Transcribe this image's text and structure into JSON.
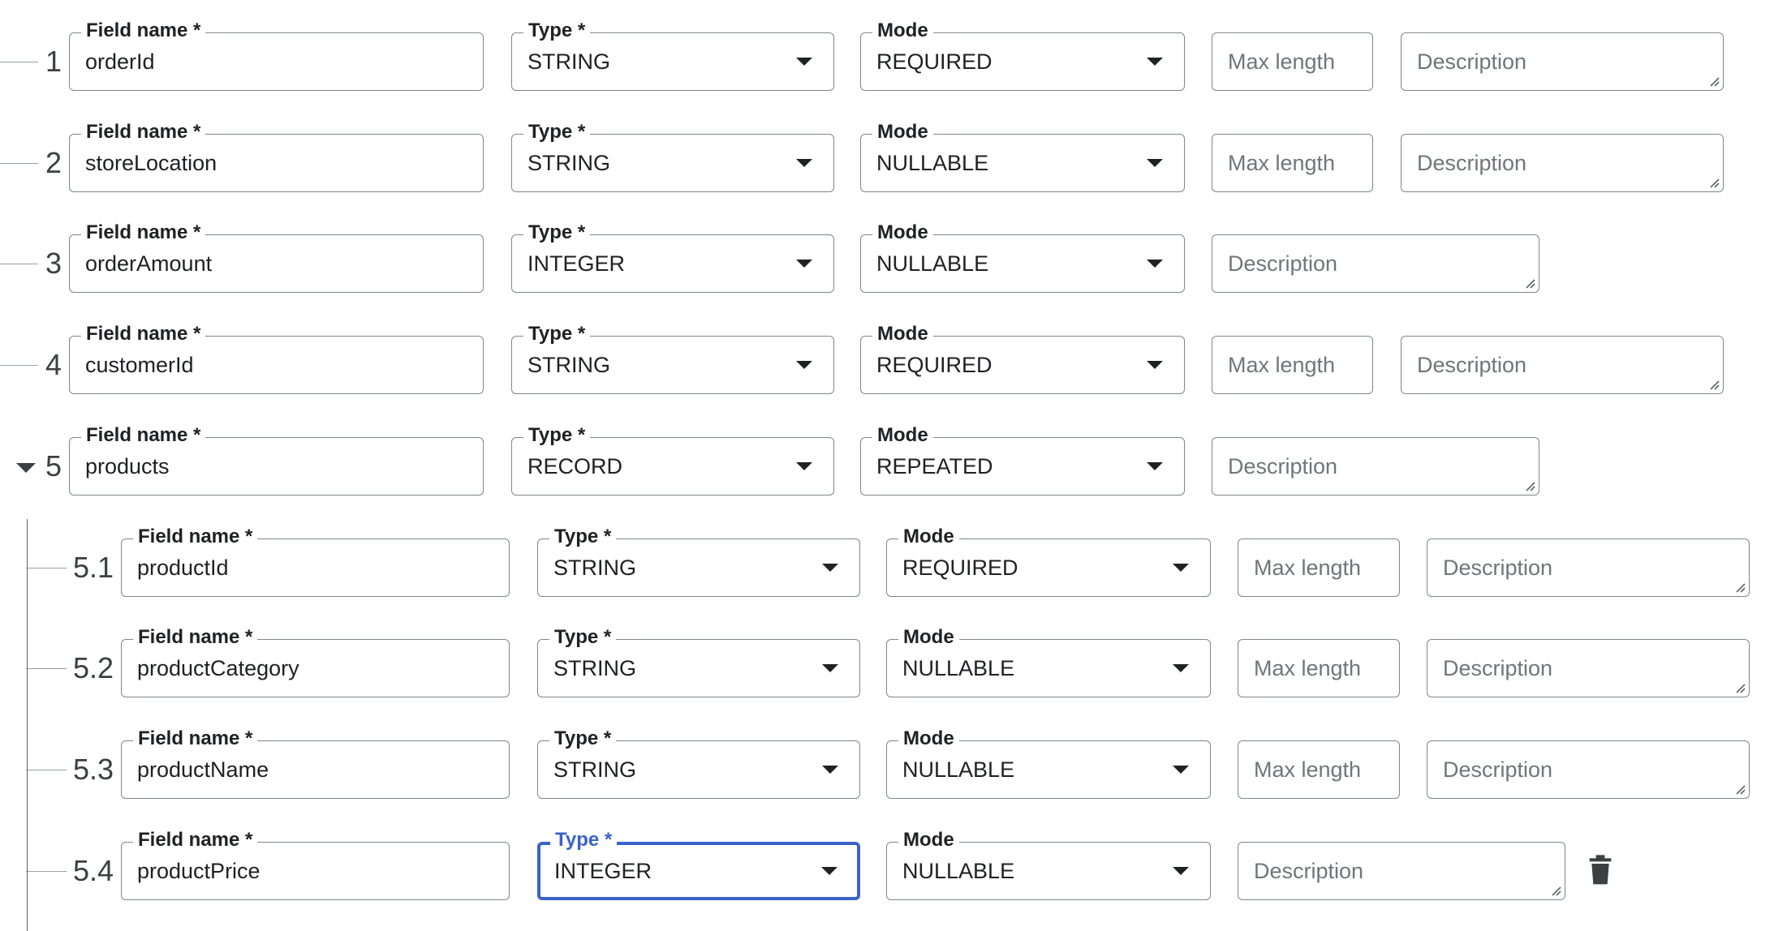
{
  "labels": {
    "field_name": "Field name *",
    "type": "Type *",
    "mode": "Mode",
    "max_length_placeholder": "Max length",
    "description_placeholder": "Description"
  },
  "icons": {
    "expand": "caret-down-icon",
    "dropdown": "arrow-drop-down-icon",
    "resize": "resize-grip-icon",
    "delete": "trash-icon"
  },
  "colors": {
    "focus_accent": "#3b62c9",
    "field_border": "#80868b"
  },
  "rows": [
    {
      "num": "1",
      "name": "orderId",
      "type": "STRING",
      "mode": "REQUIRED",
      "has_max_length": true
    },
    {
      "num": "2",
      "name": "storeLocation",
      "type": "STRING",
      "mode": "NULLABLE",
      "has_max_length": true
    },
    {
      "num": "3",
      "name": "orderAmount",
      "type": "INTEGER",
      "mode": "NULLABLE",
      "has_max_length": false
    },
    {
      "num": "4",
      "name": "customerId",
      "type": "STRING",
      "mode": "REQUIRED",
      "has_max_length": true
    },
    {
      "num": "5",
      "name": "products",
      "type": "RECORD",
      "mode": "REPEATED",
      "has_max_length": false,
      "expanded": true
    },
    {
      "num": "5.1",
      "name": "productId",
      "type": "STRING",
      "mode": "REQUIRED",
      "has_max_length": true
    },
    {
      "num": "5.2",
      "name": "productCategory",
      "type": "STRING",
      "mode": "NULLABLE",
      "has_max_length": true
    },
    {
      "num": "5.3",
      "name": "productName",
      "type": "STRING",
      "mode": "NULLABLE",
      "has_max_length": true
    },
    {
      "num": "5.4",
      "name": "productPrice",
      "type": "INTEGER",
      "mode": "NULLABLE",
      "has_max_length": false,
      "type_focused": true,
      "show_delete": true
    }
  ]
}
